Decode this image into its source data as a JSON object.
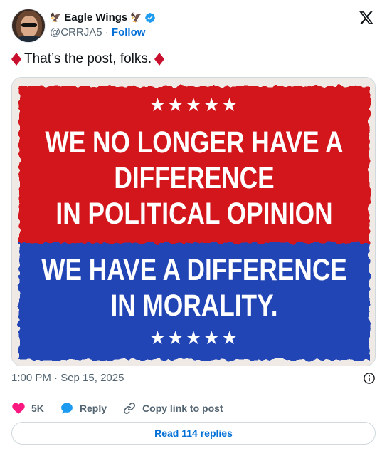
{
  "author": {
    "display_name": "Eagle Wings",
    "handle": "@CRRJA5",
    "separator": "·",
    "follow_label": "Follow",
    "name_emoji": "🦅"
  },
  "post": {
    "text": "That’s the post, folks."
  },
  "image_text": {
    "stars_top": "★★★★★",
    "line1": "WE NO LONGER HAVE A",
    "line2": "DIFFERENCE",
    "line3": "IN POLITICAL OPINION",
    "line4": "WE HAVE A DIFFERENCE",
    "line5": "IN MORALITY.",
    "stars_bottom": "★★★★★"
  },
  "meta": {
    "timestamp": "1:00 PM · Sep 15, 2025"
  },
  "actions": {
    "like_count": "5K",
    "reply_label": "Reply",
    "copy_link_label": "Copy link to post"
  },
  "read_replies_label": "Read 114 replies",
  "colors": {
    "link_blue": "#006fd6",
    "heart_pink": "#f91880",
    "reply_blue": "#1d9bf0",
    "poster_red": "#d3171c",
    "poster_blue": "#2245b5",
    "diamond_red": "#c8102e"
  },
  "icons": [
    "verified-badge-icon",
    "x-logo-icon",
    "diamond-icon",
    "info-icon",
    "heart-icon",
    "reply-bubble-icon",
    "link-icon"
  ]
}
